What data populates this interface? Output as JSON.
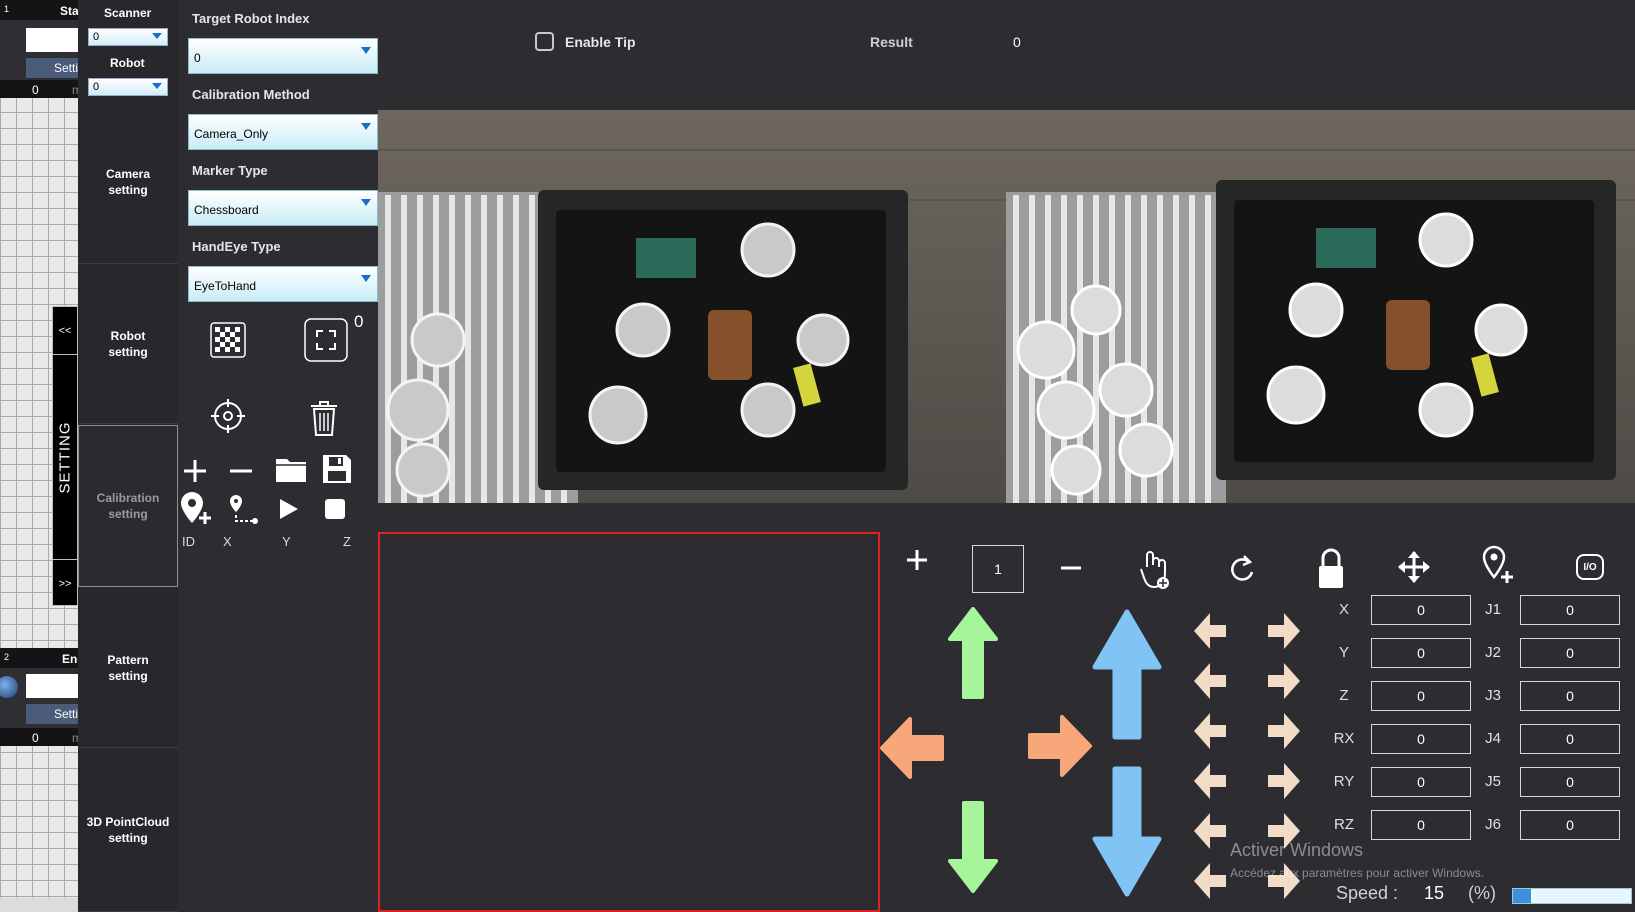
{
  "flow": {
    "node1": {
      "index": "1",
      "header": "Start",
      "setting": "Setting",
      "time_value": "0",
      "time_unit": "ms"
    },
    "node2": {
      "index": "2",
      "header": "End",
      "setting": "Setting",
      "time_value": "0",
      "time_unit": "ms"
    }
  },
  "nav": {
    "scanner_label": "Scanner",
    "scanner_value": "0",
    "robot_label": "Robot",
    "robot_value": "0",
    "items": [
      {
        "label_line1": "Camera",
        "label_line2": "setting"
      },
      {
        "label_line1": "Robot",
        "label_line2": "setting"
      },
      {
        "label_line1": "Calibration",
        "label_line2": "setting"
      },
      {
        "label_line1": "Pattern",
        "label_line2": "setting"
      },
      {
        "label_line1": "3D PointCloud",
        "label_line2": "setting"
      }
    ]
  },
  "setting_bar": {
    "collapse": "<<",
    "title": "SETTING",
    "expand": ">>"
  },
  "controls": {
    "target_robot_index": {
      "label": "Target Robot Index",
      "value": "0"
    },
    "calibration_method": {
      "label": "Calibration Method",
      "value": "Camera_Only"
    },
    "marker_type": {
      "label": "Marker Type",
      "value": "Chessboard"
    },
    "handeye_type": {
      "label": "HandEye Type",
      "value": "EyeToHand"
    },
    "count_value": "0",
    "coord_labels": {
      "id": "ID",
      "x": "X",
      "y": "Y",
      "z": "Z"
    }
  },
  "top": {
    "enable_tip_label": "Enable Tip",
    "result_label": "Result",
    "result_value": "0"
  },
  "jog": {
    "step_value": "1",
    "cartesian": [
      {
        "axis": "X",
        "value": "0"
      },
      {
        "axis": "Y",
        "value": "0"
      },
      {
        "axis": "Z",
        "value": "0"
      },
      {
        "axis": "RX",
        "value": "0"
      },
      {
        "axis": "RY",
        "value": "0"
      },
      {
        "axis": "RZ",
        "value": "0"
      }
    ],
    "joints": [
      {
        "axis": "J1",
        "value": "0"
      },
      {
        "axis": "J2",
        "value": "0"
      },
      {
        "axis": "J3",
        "value": "0"
      },
      {
        "axis": "J4",
        "value": "0"
      },
      {
        "axis": "J5",
        "value": "0"
      },
      {
        "axis": "J6",
        "value": "0"
      }
    ],
    "io_label": "I/O",
    "speed_label": "Speed :",
    "speed_value": "15",
    "speed_unit": "(%)",
    "speed_fraction": 0.15
  },
  "watermark": {
    "line1": "Activer Windows",
    "line2": "Accédez aux paramètres pour activer Windows."
  },
  "colors": {
    "accent_green": "#a6f59a",
    "accent_blue": "#7fc4f5",
    "accent_orange": "#f7a77a",
    "accent_beige": "#f2dcc8",
    "panel_border_red": "#d22222"
  }
}
